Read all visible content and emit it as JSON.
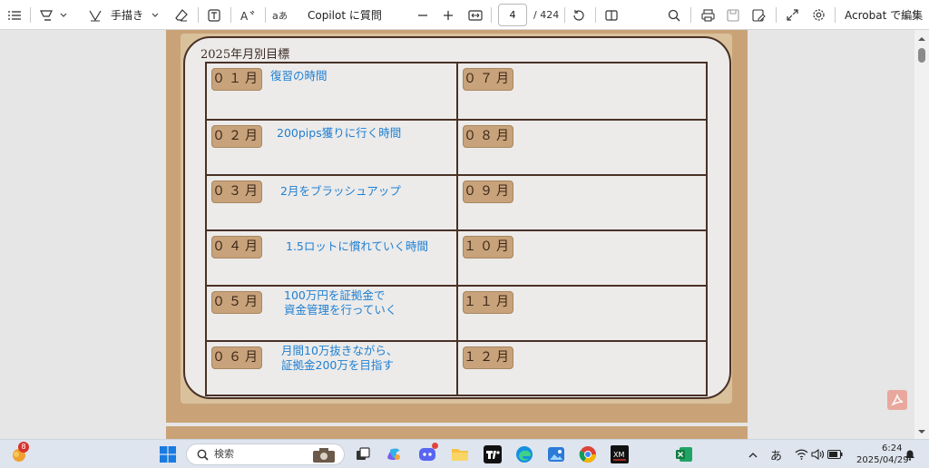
{
  "toolbar": {
    "draw_label": "手描き",
    "copilot_label": "Copilot に質問",
    "current_page": "4",
    "total_pages": "/ 424",
    "edit_label": "Acrobat で編集"
  },
  "document": {
    "title": "2025年月別目標",
    "months": [
      {
        "label": "０１月",
        "goal": "復習の時間"
      },
      {
        "label": "０２月",
        "goal": "200pips獲りに行く時間"
      },
      {
        "label": "０３月",
        "goal": "2月をブラッシュアップ"
      },
      {
        "label": "０４月",
        "goal": "1.5ロットに慣れていく時間"
      },
      {
        "label": "０５月",
        "goal": "100万円を証拠金で\n資金管理を行っていく"
      },
      {
        "label": "０６月",
        "goal": "月間10万抜きながら、\n証拠金200万を目指す"
      },
      {
        "label": "０７月",
        "goal": ""
      },
      {
        "label": "０８月",
        "goal": ""
      },
      {
        "label": "０９月",
        "goal": ""
      },
      {
        "label": "１０月",
        "goal": ""
      },
      {
        "label": "１１月",
        "goal": ""
      },
      {
        "label": "１２月",
        "goal": ""
      }
    ]
  },
  "taskbar": {
    "search_placeholder": "検索",
    "notification_count": "8",
    "ime_label": "あ",
    "time": "6:24",
    "date": "2025/04/29"
  },
  "colors": {
    "accent_text": "#1f7fd1",
    "frame": "#4a3126",
    "badge": "#c8a27a"
  }
}
